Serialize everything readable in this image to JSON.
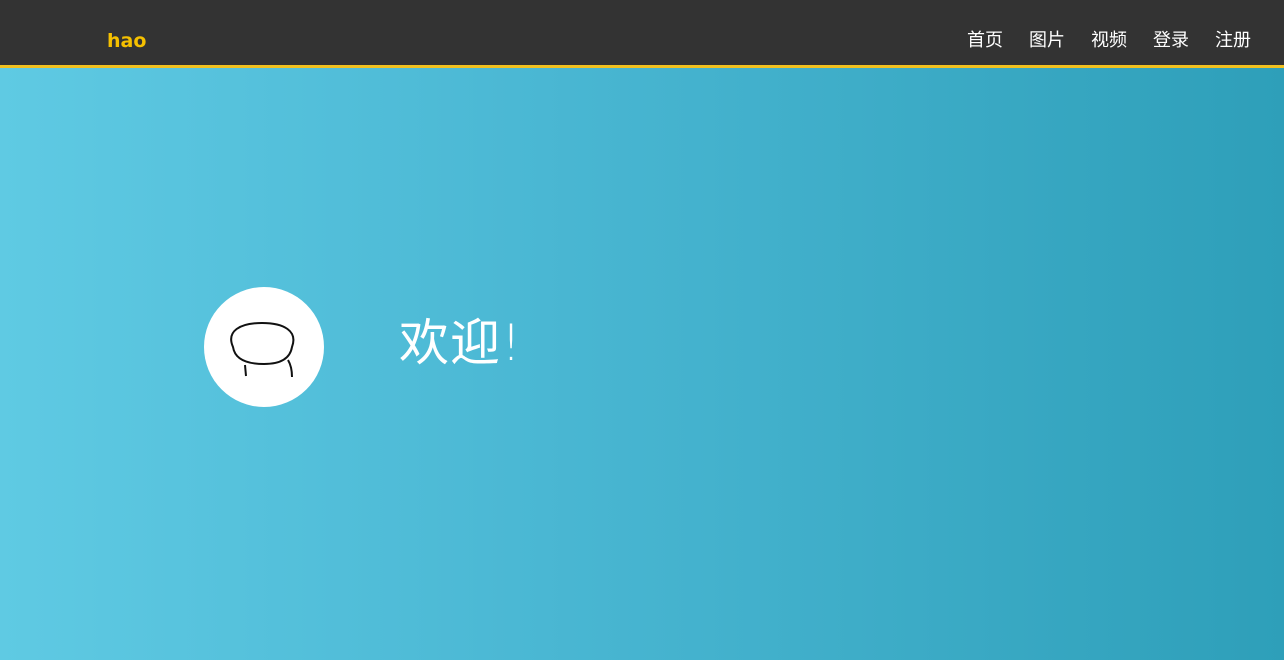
{
  "header": {
    "brand": "hao",
    "nav": [
      "首页",
      "图片",
      "视频",
      "登录",
      "注册"
    ]
  },
  "hero": {
    "welcome": "欢迎!"
  },
  "icons": {
    "avatar": "avatar-face-icon"
  },
  "colors": {
    "topbar": "#333333",
    "accent": "#f5c000",
    "hero_gradient_start": "#5fcae3",
    "hero_gradient_end": "#2e9fb9"
  }
}
